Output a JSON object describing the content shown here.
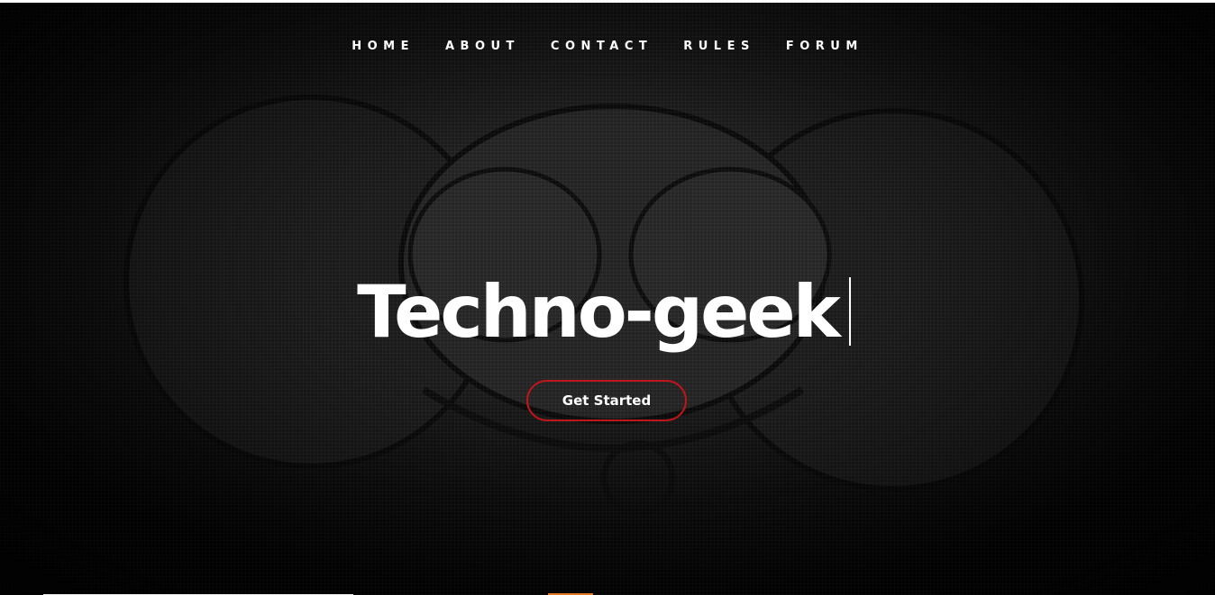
{
  "nav": {
    "items": [
      {
        "label": "HOME"
      },
      {
        "label": "ABOUT"
      },
      {
        "label": "CONTACT"
      },
      {
        "label": "RULES"
      },
      {
        "label": "FORUM"
      }
    ]
  },
  "hero": {
    "title": "Techno-geek",
    "cta_label": "Get Started",
    "background_icon": "deadmau5-mouse-head-icon"
  },
  "colors": {
    "background": "#060606",
    "text": "#ffffff",
    "cta_border": "#c0151b",
    "accent": "#e07a28"
  }
}
